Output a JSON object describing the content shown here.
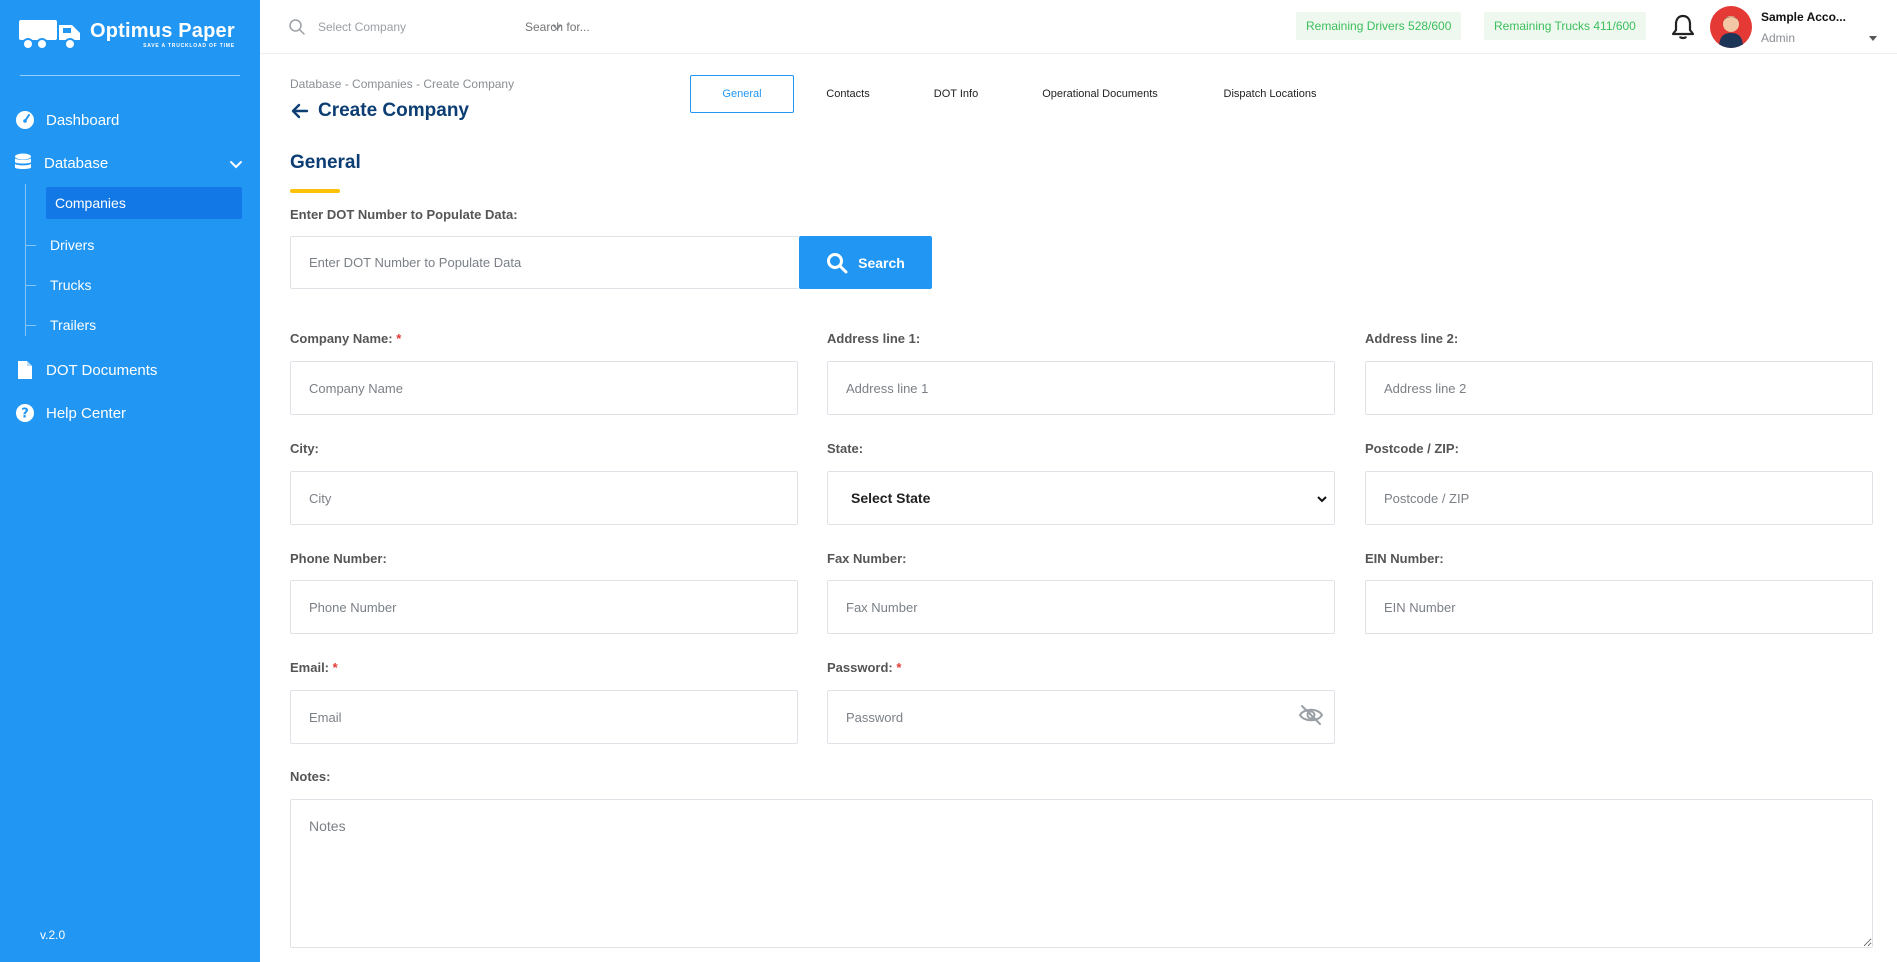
{
  "brand": {
    "name": "Optimus Paper",
    "tagline": "SAVE A TRUCKLOAD OF TIME",
    "version": "v.2.0"
  },
  "sidebar": {
    "items": [
      {
        "label": "Dashboard",
        "icon": "gauge-icon"
      },
      {
        "label": "Database",
        "icon": "database-icon"
      },
      {
        "label": "DOT Documents",
        "icon": "document-icon"
      },
      {
        "label": "Help Center",
        "icon": "help-icon"
      }
    ],
    "database_children": [
      {
        "label": "Companies",
        "active": true
      },
      {
        "label": "Drivers"
      },
      {
        "label": "Trucks"
      },
      {
        "label": "Trailers"
      }
    ]
  },
  "topbar": {
    "company_select_placeholder": "Select Company",
    "search_placeholder": "Search for...",
    "remaining_drivers": "Remaining Drivers 528/600",
    "remaining_trucks": "Remaining Trucks 411/600",
    "user_name": "Sample Acco...",
    "user_role": "Admin"
  },
  "breadcrumb": "Database - Companies - Create Company",
  "page_title": "Create Company",
  "tabs": [
    {
      "label": "General",
      "active": true
    },
    {
      "label": "Contacts"
    },
    {
      "label": "DOT Info"
    },
    {
      "label": "Operational Documents"
    },
    {
      "label": "Dispatch Locations"
    }
  ],
  "section_title": "General",
  "dot_lookup": {
    "label": "Enter DOT Number to Populate Data:",
    "placeholder": "Enter DOT Number to Populate Data",
    "button": "Search"
  },
  "form": {
    "company_name": {
      "label": "Company Name:",
      "required": "*",
      "placeholder": "Company Name"
    },
    "address1": {
      "label": "Address line 1:",
      "placeholder": "Address line 1"
    },
    "address2": {
      "label": "Address line 2:",
      "placeholder": "Address line 2"
    },
    "city": {
      "label": "City:",
      "placeholder": "City"
    },
    "state": {
      "label": "State:",
      "value": "Select State"
    },
    "postcode": {
      "label": "Postcode / ZIP:",
      "placeholder": "Postcode / ZIP"
    },
    "phone": {
      "label": "Phone Number:",
      "placeholder": "Phone Number"
    },
    "fax": {
      "label": "Fax Number:",
      "placeholder": "Fax Number"
    },
    "ein": {
      "label": "EIN Number:",
      "placeholder": "EIN Number"
    },
    "email": {
      "label": "Email:",
      "required": "*",
      "placeholder": "Email"
    },
    "password": {
      "label": "Password:",
      "required": "*",
      "placeholder": "Password"
    },
    "notes": {
      "label": "Notes:",
      "placeholder": "Notes"
    }
  },
  "colors": {
    "primary": "#2196f3",
    "active_nav": "#1278e6",
    "title": "#0d3e73",
    "accent": "#ffc107",
    "pill_text": "#3cbf5c",
    "required": "#e53935"
  }
}
